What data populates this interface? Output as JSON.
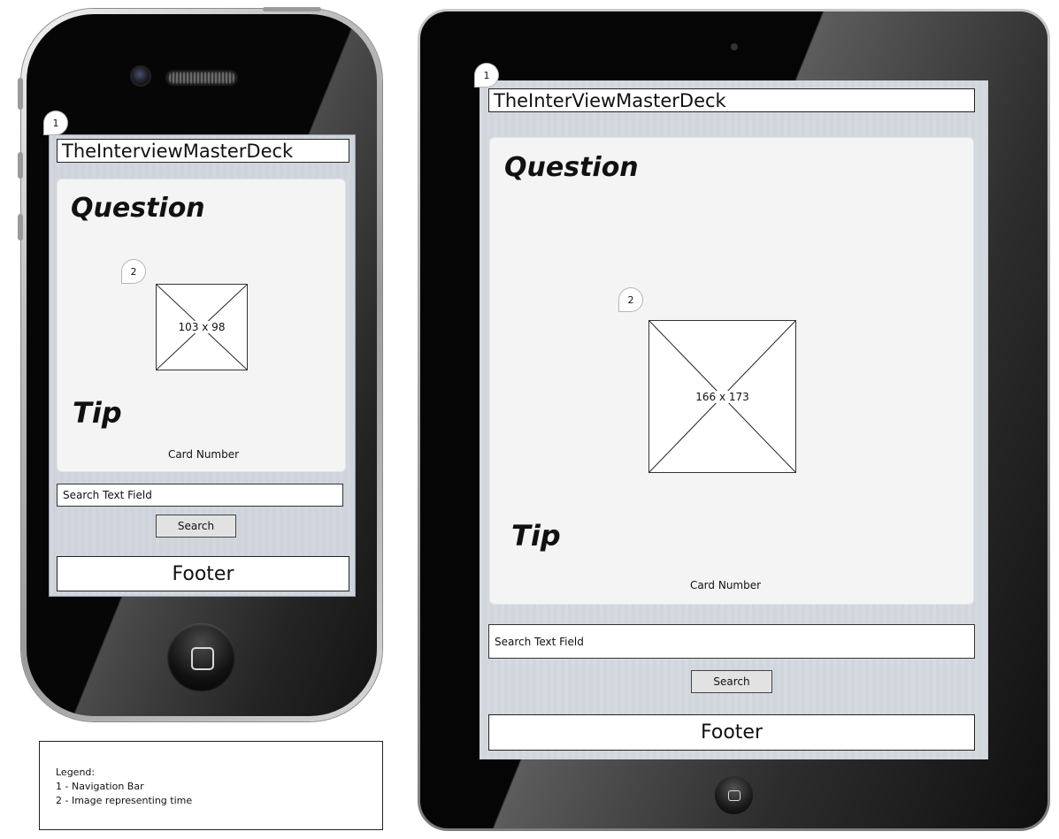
{
  "iphone": {
    "nav_title": "TheInterviewMasterDeck",
    "question_label": "Question",
    "image_placeholder": "103 x 98",
    "tip_label": "Tip",
    "card_number": "Card Number",
    "search_field": "Search Text Field",
    "search_button": "Search",
    "footer": "Footer"
  },
  "ipad": {
    "nav_title": "TheInterViewMasterDeck",
    "question_label": "Question",
    "image_placeholder": "166 x 173",
    "tip_label": "Tip",
    "card_number": "Card Number",
    "search_field": "Search Text Field",
    "search_button": "Search",
    "footer": "Footer"
  },
  "callouts": {
    "one": "1",
    "two": "2"
  },
  "legend": {
    "title": "Legend:",
    "items": [
      "1 - Navigation Bar",
      "2 - Image representing time"
    ]
  }
}
